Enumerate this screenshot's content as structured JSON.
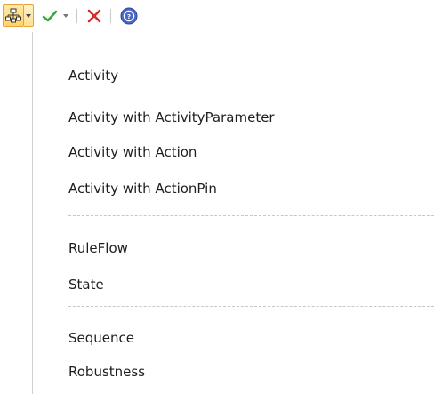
{
  "toolbar": {
    "icons": [
      "hierarchy-icon",
      "chevron-down-icon",
      "checkmark-icon",
      "chevron-down-icon",
      "close-icon",
      "help-icon"
    ],
    "colors": {
      "hover_fill": "#ffd36b",
      "hover_border": "#e3a43c",
      "check": "#3aa63a",
      "cancel": "#d42a2a",
      "help": "#4a67c8"
    }
  },
  "menu": {
    "groups": [
      {
        "items": [
          {
            "label": "Activity"
          },
          {
            "label": "Activity with ActivityParameter"
          },
          {
            "label": "Activity with Action"
          },
          {
            "label": "Activity with ActionPin"
          }
        ]
      },
      {
        "items": [
          {
            "label": "RuleFlow"
          },
          {
            "label": "State"
          }
        ]
      },
      {
        "items": [
          {
            "label": "Sequence"
          },
          {
            "label": "Robustness"
          }
        ]
      }
    ]
  }
}
